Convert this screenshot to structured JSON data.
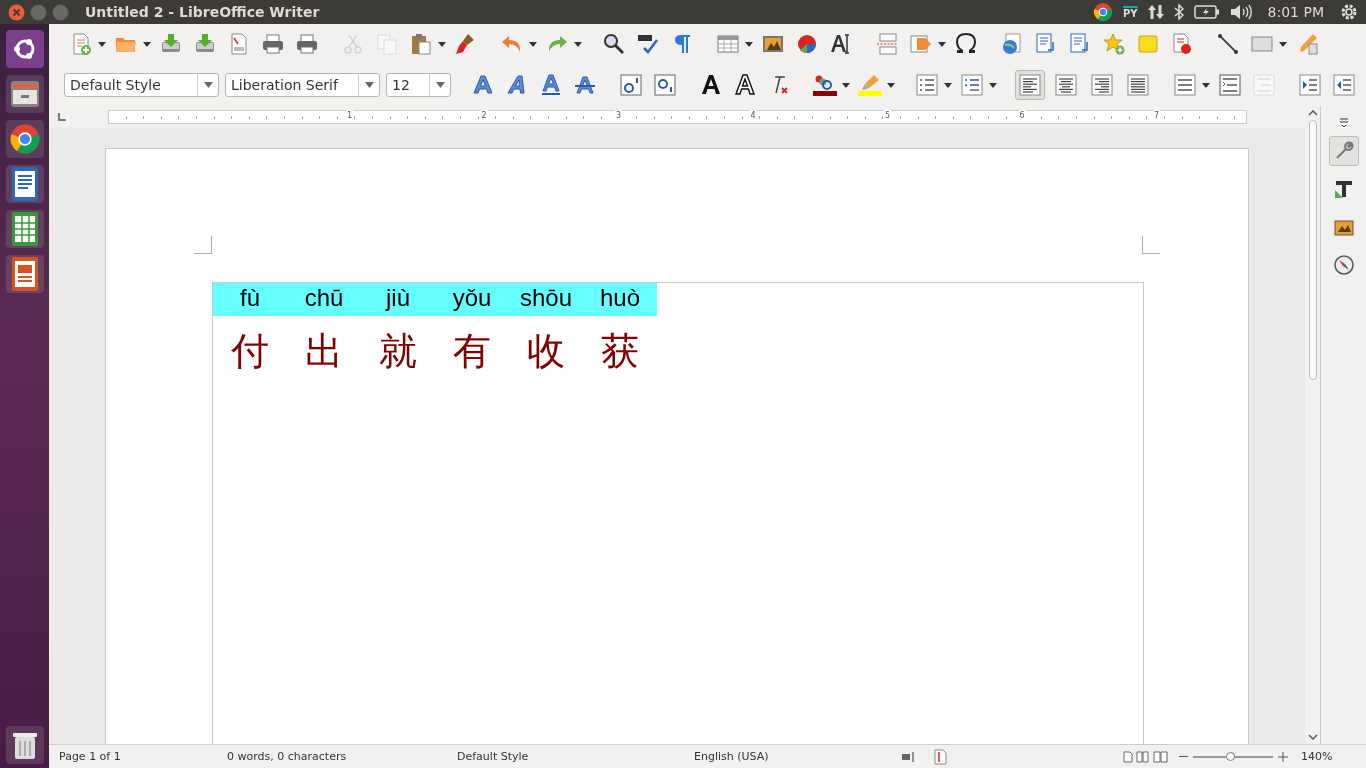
{
  "window": {
    "title": "Untitled 2 - LibreOffice Writer"
  },
  "top_panel": {
    "input_method": "PY",
    "clock": "8:01 PM"
  },
  "formatting": {
    "paragraph_style": "Default Style",
    "font_name": "Liberation Serif",
    "font_size": "12"
  },
  "alignment": [
    {
      "kind": "left",
      "selected": true
    },
    {
      "kind": "center",
      "selected": false
    },
    {
      "kind": "right",
      "selected": false
    },
    {
      "kind": "justify",
      "selected": false
    }
  ],
  "ruler": {
    "numbers": [
      "1",
      "2",
      "3",
      "4",
      "5",
      "6",
      "7"
    ]
  },
  "document": {
    "ruby": [
      {
        "reading": "fù",
        "base": "付"
      },
      {
        "reading": "chū",
        "base": "出"
      },
      {
        "reading": "jiù",
        "base": "就"
      },
      {
        "reading": "yǒu",
        "base": "有"
      },
      {
        "reading": "shōu",
        "base": "收"
      },
      {
        "reading": "huò",
        "base": "获"
      }
    ]
  },
  "status_bar": {
    "page": "Page 1 of 1",
    "count": "0 words, 0 characters",
    "style": "Default Style",
    "language": "English (USA)",
    "zoom": "140%",
    "level": 0.46
  }
}
